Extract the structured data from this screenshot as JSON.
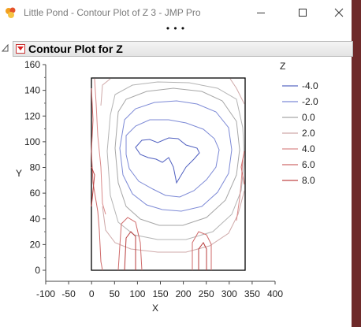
{
  "window": {
    "title": "Little Pond - Contour Plot of Z 3 - JMP Pro",
    "grip": "• • •"
  },
  "report": {
    "title": "Contour Plot for Z"
  },
  "plot": {
    "xlabel": "X",
    "ylabel": "Y",
    "xticks": [
      "-100",
      "-50",
      "0",
      "50",
      "100",
      "150",
      "200",
      "250",
      "300",
      "350",
      "400"
    ],
    "yticks": [
      "160",
      "140",
      "120",
      "100",
      "80",
      "60",
      "40",
      "20",
      "0"
    ]
  },
  "legend": {
    "title": "Z",
    "items": [
      {
        "label": "-4.0",
        "color": "#5b6bc4"
      },
      {
        "label": "-2.0",
        "color": "#7d8ad6"
      },
      {
        "label": "0.0",
        "color": "#a6a6a6"
      },
      {
        "label": "2.0",
        "color": "#cfa9a9"
      },
      {
        "label": "4.0",
        "color": "#d98a8a"
      },
      {
        "label": "6.0",
        "color": "#cf6a6a"
      },
      {
        "label": "8.0",
        "color": "#c04848"
      }
    ]
  },
  "chart_data": {
    "type": "contour",
    "xlabel": "X",
    "ylabel": "Y",
    "xlim": [
      -100,
      400
    ],
    "ylim": [
      0,
      160
    ],
    "legend_title": "Z",
    "levels": [
      -4.0,
      -2.0,
      0.0,
      2.0,
      4.0,
      6.0,
      8.0
    ],
    "data_extent": {
      "x": [
        0,
        350
      ],
      "y": [
        0,
        150
      ]
    },
    "legend_position": "right"
  }
}
